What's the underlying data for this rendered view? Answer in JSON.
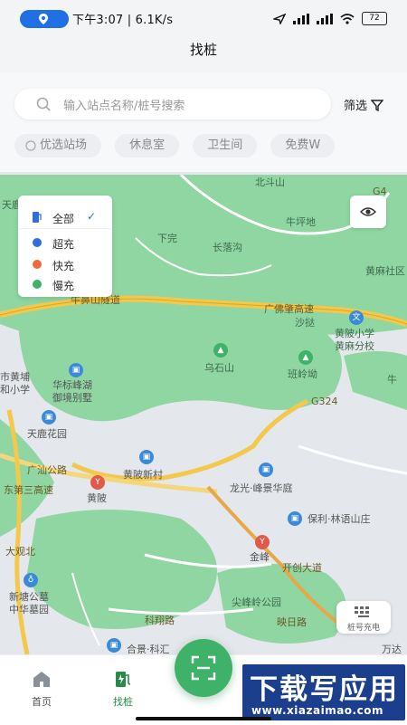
{
  "status_bar": {
    "time": "下午3:07 | 6.1K/s",
    "battery": "72"
  },
  "header": {
    "title": "找桩"
  },
  "search": {
    "placeholder": "输入站点名称/桩号搜索",
    "filter_label": "筛选"
  },
  "chips": [
    "优选站场",
    "休息室",
    "卫生间",
    "免费W"
  ],
  "legend": {
    "items": [
      {
        "label": "全部",
        "color": "#2f6fdb"
      },
      {
        "label": "超充",
        "color": "#2f6fdb"
      },
      {
        "label": "快充",
        "color": "#f06a3a"
      },
      {
        "label": "慢充",
        "color": "#3fb26a"
      }
    ]
  },
  "map_labels": {
    "beidoushan": "北斗山",
    "tianlu": "天鹿",
    "xiawan": "下完",
    "changluogou": "长落沟",
    "niupingdi": "牛坪地",
    "huangmashe": "黄麻社区",
    "g4": "G4",
    "niubishan": "牛鼻山隧道",
    "guangfo": "广佛肇高速",
    "shawan": "沙挞",
    "huangpi_school": "黄陂小学",
    "huangma_branch": "黄麻分校",
    "wushishan": "乌石山",
    "banlingao": "班岭坳",
    "g324": "G324",
    "niu_short": "牛",
    "huangpu_school": "市黄埔",
    "hexiaoxue": "和小学",
    "huabiao": "华标峰湖",
    "yujing": "御境别墅",
    "tianluhuayuan": "天鹿花园",
    "guangshan": "广汕公路",
    "huangpixincun": "黄陂新村",
    "huangpi": "黄陂",
    "longguang": "龙光·峰景华庭",
    "baoli": "保利·林语山庄",
    "jinfeng": "金峰",
    "kaichuang": "开创大道",
    "tiaodong": "东第三高速",
    "dagaohu": "大观北",
    "xintang": "新塘公墓",
    "zhonghua": "中华墓园",
    "jianfengling": "尖峰岭公园",
    "kexiang": "科翔路",
    "yingri": "映日路",
    "heqing": "合景·科汇",
    "wanzhi": "万达"
  },
  "map_buttons": {
    "kbd_label": "桩号充电"
  },
  "bottom_nav": {
    "items": [
      {
        "label": "首页",
        "color": "#666666"
      },
      {
        "label": "找桩",
        "color": "#2a8a4a"
      }
    ]
  },
  "watermark": {
    "title": "下载写应用",
    "url": "www.xiazaimao.com"
  }
}
